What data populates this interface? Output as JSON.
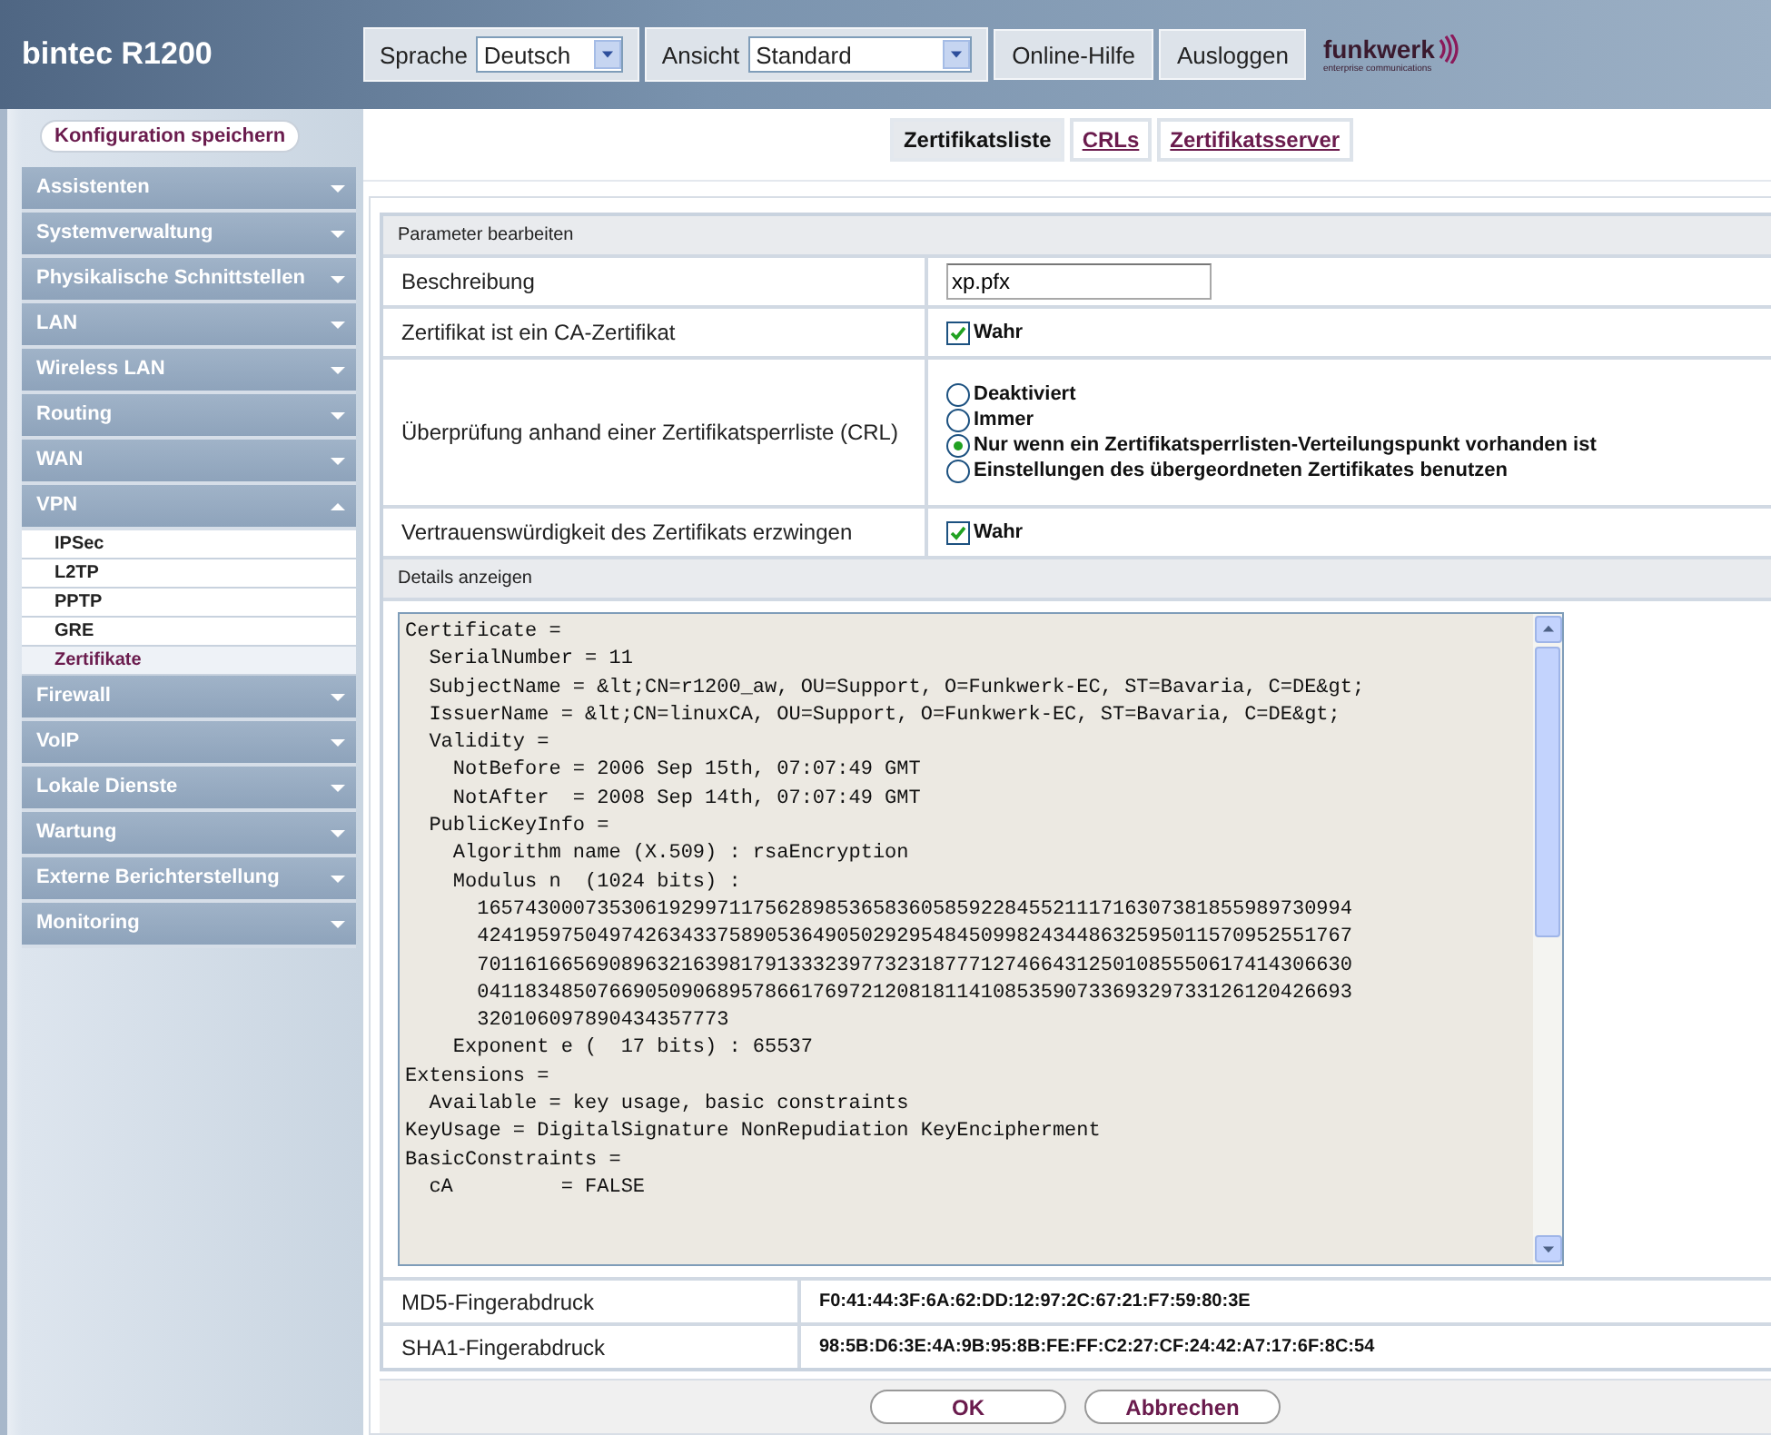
{
  "header": {
    "product": "bintec R1200",
    "language": {
      "label": "Sprache",
      "value": "Deutsch"
    },
    "view": {
      "label": "Ansicht",
      "value": "Standard"
    },
    "buttons": [
      "Online-Hilfe",
      "Ausloggen"
    ],
    "logo": {
      "name": "funkwerk",
      "tagline": "enterprise communications"
    }
  },
  "sidebar": {
    "save_button": "Konfiguration speichern",
    "items": [
      {
        "label": "Assistenten",
        "expanded": false
      },
      {
        "label": "Systemverwaltung",
        "expanded": false
      },
      {
        "label": "Physikalische Schnittstellen",
        "expanded": false
      },
      {
        "label": "LAN",
        "expanded": false
      },
      {
        "label": "Wireless LAN",
        "expanded": false
      },
      {
        "label": "Routing",
        "expanded": false
      },
      {
        "label": "WAN",
        "expanded": false
      },
      {
        "label": "VPN",
        "expanded": true,
        "children": [
          {
            "label": "IPSec",
            "selected": false
          },
          {
            "label": "L2TP",
            "selected": false
          },
          {
            "label": "PPTP",
            "selected": false
          },
          {
            "label": "GRE",
            "selected": false
          },
          {
            "label": "Zertifikate",
            "selected": true
          }
        ]
      },
      {
        "label": "Firewall",
        "expanded": false
      },
      {
        "label": "VoIP",
        "expanded": false
      },
      {
        "label": "Lokale Dienste",
        "expanded": false
      },
      {
        "label": "Wartung",
        "expanded": false
      },
      {
        "label": "Externe Berichterstellung",
        "expanded": false
      },
      {
        "label": "Monitoring",
        "expanded": false
      }
    ]
  },
  "tabs": [
    {
      "label": "Zertifikatsliste",
      "selected": true
    },
    {
      "label": "CRLs",
      "selected": false
    },
    {
      "label": "Zertifikatsserver",
      "selected": false
    }
  ],
  "form": {
    "section": "Parameter bearbeiten",
    "rows": [
      {
        "kind": "text",
        "label": "Beschreibung",
        "value": "xp.pfx"
      },
      {
        "kind": "checkbox",
        "label": "Zertifikat ist ein CA-Zertifikat",
        "option": "Wahr",
        "checked": true
      },
      {
        "kind": "radio",
        "label": "Überprüfung anhand einer Zertifikatsperrliste (CRL)",
        "options": [
          {
            "label": "Deaktiviert",
            "selected": false
          },
          {
            "label": "Immer",
            "selected": false
          },
          {
            "label": "Nur wenn ein Zertifikatsperrlisten-Verteilungspunkt vorhanden ist",
            "selected": true
          },
          {
            "label": "Einstellungen des übergeordneten Zertifikates benutzen",
            "selected": false
          }
        ]
      },
      {
        "kind": "checkbox",
        "label": "Vertrauenswürdigkeit des Zertifikats erzwingen",
        "option": "Wahr",
        "checked": true
      }
    ]
  },
  "details": {
    "section": "Details anzeigen",
    "lines": [
      "Certificate =",
      "  SerialNumber = 11",
      "  SubjectName = &lt;CN=r1200_aw, OU=Support, O=Funkwerk-EC, ST=Bavaria, C=DE&gt;",
      "  IssuerName = &lt;CN=linuxCA, OU=Support, O=Funkwerk-EC, ST=Bavaria, C=DE&gt;",
      "  Validity =",
      "    NotBefore = 2006 Sep 15th, 07:07:49 GMT",
      "    NotAfter  = 2008 Sep 14th, 07:07:49 GMT",
      "  PublicKeyInfo =",
      "    Algorithm name (X.509) : rsaEncryption",
      "    Modulus n  (1024 bits) :",
      "      1657430007353061929971175628985365836058592284552111716307381855989730994",
      "      4241959750497426343375890536490502929548450998243448632595011570952551767",
      "      7011616656908963216398179133323977323187771274664312501085550617414306630",
      "      0411834850766905090689578661769721208181141085359073369329733126120426693",
      "      320106097890434357773",
      "    Exponent e (  17 bits) : 65537",
      "Extensions =",
      "  Available = key usage, basic constraints",
      "KeyUsage = DigitalSignature NonRepudiation KeyEncipherment",
      "BasicConstraints =",
      "  cA         = FALSE"
    ]
  },
  "fingerprints": [
    {
      "label": "MD5-Fingerabdruck",
      "value": "F0:41:44:3F:6A:62:DD:12:97:2C:67:21:F7:59:80:3E"
    },
    {
      "label": "SHA1-Fingerabdruck",
      "value": "98:5B:D6:3E:4A:9B:95:8B:FE:FF:C2:27:CF:24:42:A7:17:6F:8C:54"
    }
  ],
  "footer_buttons": [
    "OK",
    "Abbrechen"
  ]
}
